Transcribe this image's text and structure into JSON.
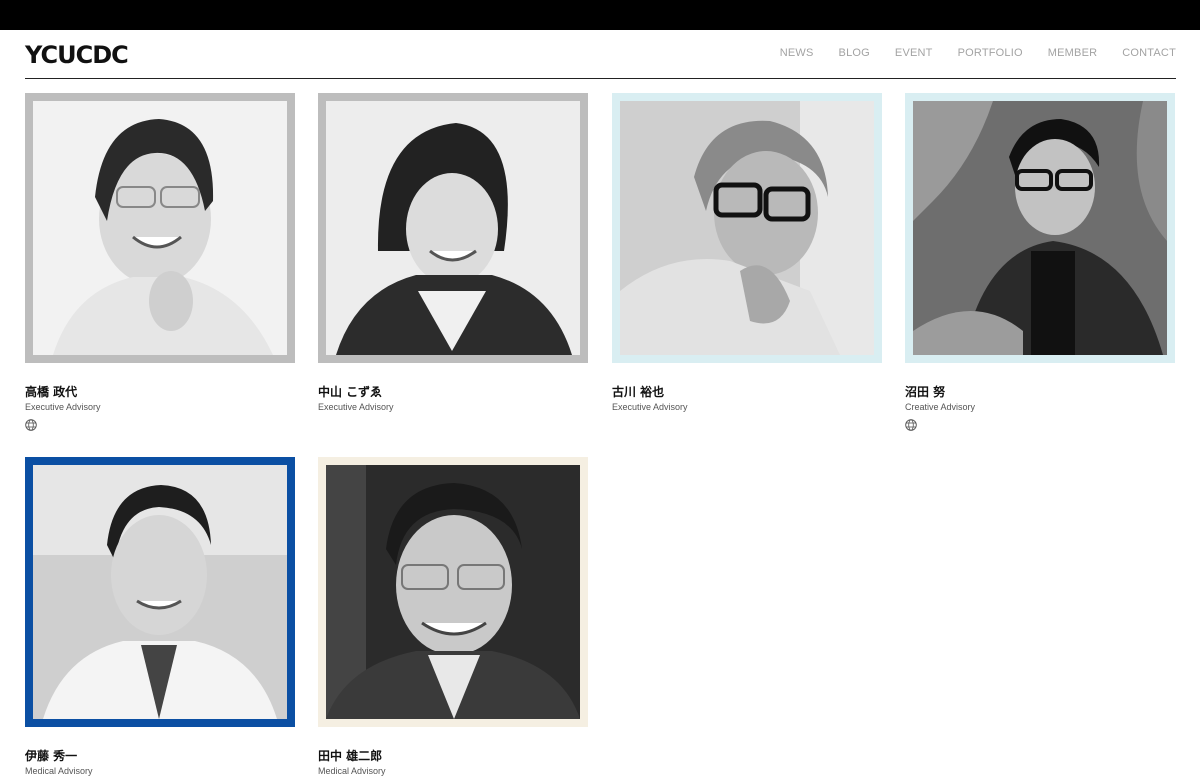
{
  "header": {
    "logo": "YCUCDC",
    "nav": [
      "NEWS",
      "BLOG",
      "EVENT",
      "PORTFOLIO",
      "MEMBER",
      "CONTACT"
    ]
  },
  "members": [
    {
      "name": "高橋 政代",
      "role": "Executive Advisory",
      "frame_color": "#bdbdbd",
      "bg_color": "#f2f2f2",
      "globe": "globe-icon"
    },
    {
      "name": "中山 こずゑ",
      "role": "Executive Advisory",
      "frame_color": "#bdbdbd",
      "bg_color": "#ededed"
    },
    {
      "name": "古川 裕也",
      "role": "Executive Advisory",
      "frame_color": "#d9eef2",
      "bg_color": "#cfcfcf"
    },
    {
      "name": "沼田 努",
      "role": "Creative Advisory",
      "frame_color": "#d9eef2",
      "bg_color": "#6e6e6e",
      "globe": "globe-icon"
    },
    {
      "name": "伊藤 秀一",
      "role": "Medical Advisory",
      "frame_color": "#0b4fa3",
      "bg_color": "#cfcfcf"
    },
    {
      "name": "田中 雄二郎",
      "role": "Medical Advisory",
      "frame_color": "#f5efe2",
      "bg_color": "#2b2b2b"
    }
  ]
}
